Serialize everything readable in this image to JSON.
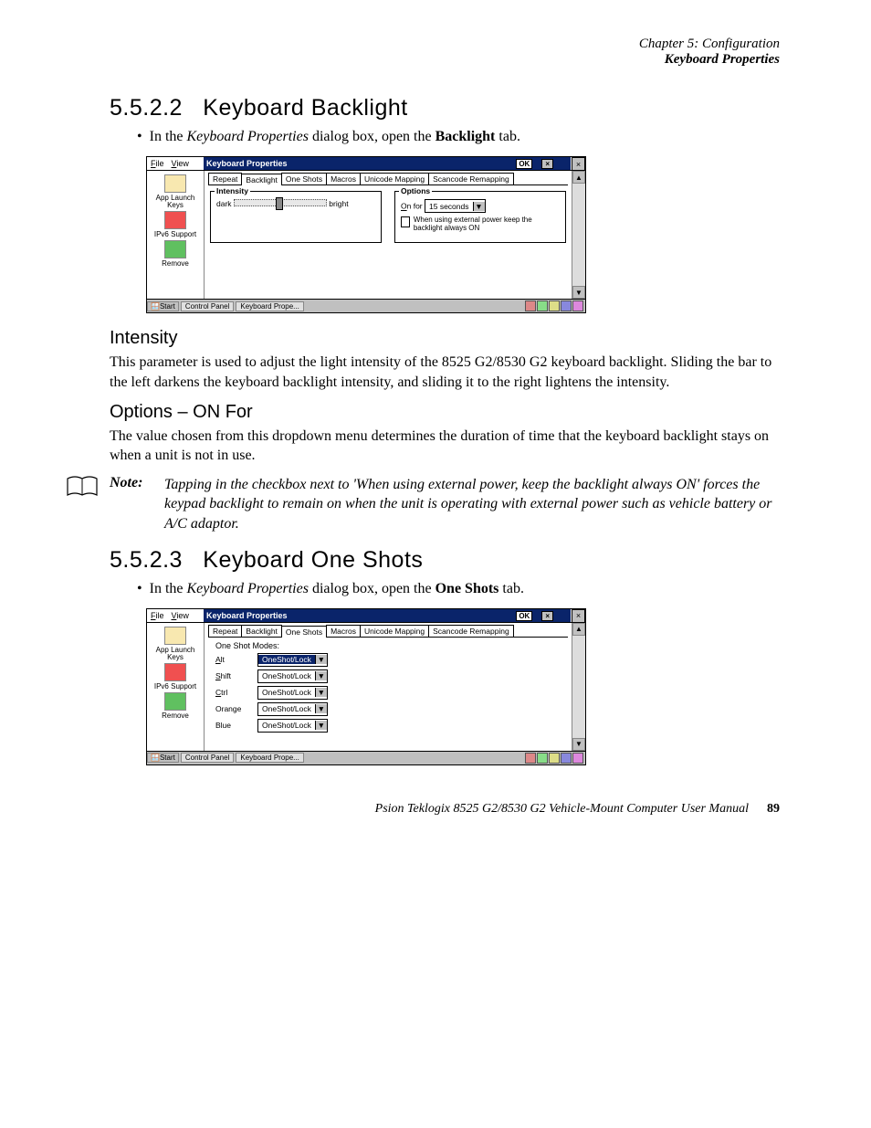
{
  "header": {
    "line1": "Chapter 5: Configuration",
    "line2": "Keyboard Properties"
  },
  "sec1": {
    "num": "5.5.2.2",
    "title": "Keyboard Backlight",
    "bullet_pre": "In the ",
    "bullet_it": "Keyboard Properties",
    "bullet_mid": " dialog box, open the ",
    "bullet_bold": "Backlight",
    "bullet_post": " tab."
  },
  "shot1": {
    "menu_file": "File",
    "menu_view": "View",
    "title": "Keyboard Properties",
    "ok": "OK",
    "x": "×",
    "tabs": [
      "Repeat",
      "Backlight",
      "One Shots",
      "Macros",
      "Unicode Mapping",
      "Scancode Remapping"
    ],
    "fs1_legend": "Intensity",
    "fs1_dark": "dark",
    "fs1_bright": "bright",
    "fs2_legend": "Options",
    "fs2_onfor": "On for",
    "fs2_dd": "15 seconds",
    "fs2_cb": "When using external power keep the backlight always ON",
    "side1": "App Launch Keys",
    "side2": "IPv6 Support",
    "side3": "Remove",
    "tb_start": "Start",
    "tb_cp": "Control Panel",
    "tb_kp": "Keyboard Prope..."
  },
  "sub1": {
    "title": "Intensity",
    "body": "This parameter is used to adjust the light intensity of the 8525 G2/8530 G2 keyboard backlight. Sliding the bar to the left darkens the keyboard backlight intensity, and sliding it to the right lightens the intensity."
  },
  "sub2": {
    "title": "Options – ON For",
    "body": "The value chosen from this dropdown menu determines the duration of time that the keyboard backlight stays on when a unit is not in use."
  },
  "note": {
    "label": "Note:",
    "body": "Tapping in the checkbox next to 'When using external power, keep the backlight always ON' forces the keypad backlight to remain on when the unit is operating with external power such as vehicle battery or A/C adaptor."
  },
  "sec2": {
    "num": "5.5.2.3",
    "title": "Keyboard One Shots",
    "bullet_pre": "In the ",
    "bullet_it": "Keyboard Properties",
    "bullet_mid": " dialog box, open the ",
    "bullet_bold": "One Shots",
    "bullet_post": " tab."
  },
  "shot2": {
    "osm": "One Shot Modes:",
    "rows": {
      "alt": "Alt",
      "shift": "Shift",
      "ctrl": "Ctrl",
      "orange": "Orange",
      "blue": "Blue"
    },
    "val": "OneShot/Lock"
  },
  "footer": {
    "text": "Psion Teklogix 8525 G2/8530 G2 Vehicle-Mount Computer User Manual",
    "page": "89"
  }
}
